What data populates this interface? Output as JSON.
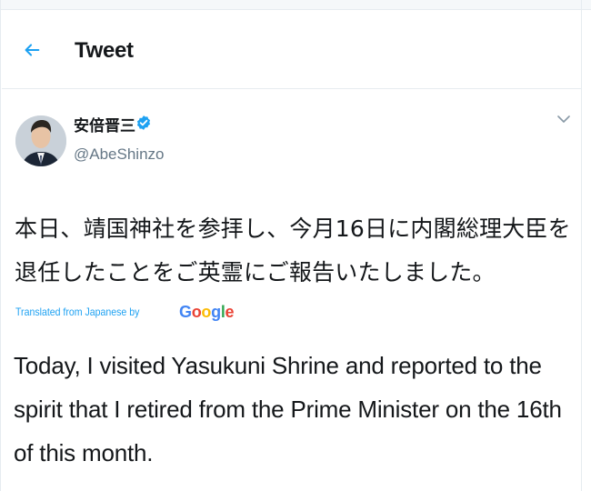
{
  "header": {
    "title": "Tweet",
    "back_icon": "arrow-left-icon"
  },
  "tweet": {
    "author_name": "安倍晋三",
    "author_handle": "@AbeShinzo",
    "verified_icon": "verified-badge-icon",
    "more_icon": "chevron-down-icon",
    "text_japanese_line1": "本日、靖国神社を参拝し、今月16日に内閣総理大臣を",
    "text_japanese_line2": "退任したことをご英霊にご報告いたしました。",
    "translated_label": "Translated from Japanese by",
    "translator_brand": "Google",
    "text_english": "Today, I visited Yasukuni Shrine and reported to the spirit that I retired from the Prime Minister on the 16th of this month."
  },
  "colors": {
    "accent": "#1da1f2",
    "text": "#14171a",
    "muted": "#657786",
    "divider": "#e6ecf0"
  }
}
